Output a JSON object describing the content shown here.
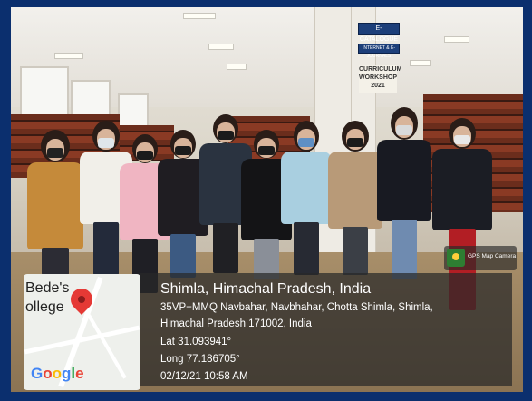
{
  "signs": {
    "catalogue": "E-CATALOGUE",
    "resource": "INTERNET & E-JOURNALS",
    "workshop_l1": "CURRICULUM",
    "workshop_l2": "WORKSHOP",
    "workshop_l3": "2021"
  },
  "badge": {
    "label": "GPS Map Camera",
    "icon": "gps-map-camera-icon"
  },
  "map": {
    "label_top": "Bede's",
    "label_bottom": "ollege",
    "logo": "Google",
    "pin_icon": "map-pin-icon",
    "pin_color": "#e53935"
  },
  "location": {
    "title": "Shimla, Himachal Pradesh, India",
    "address_line1": "35VP+MMQ Navbahar, Navbhahar, Chotta Shimla, Shimla,",
    "address_line2": "Himachal Pradesh 171002, India",
    "lat": "Lat 31.093941°",
    "long": "Long 77.186705°",
    "datetime": "02/12/21 10:58 AM"
  },
  "colors": {
    "frame": "#0b2f6e",
    "overlay": "rgba(40,40,40,0.72)"
  }
}
